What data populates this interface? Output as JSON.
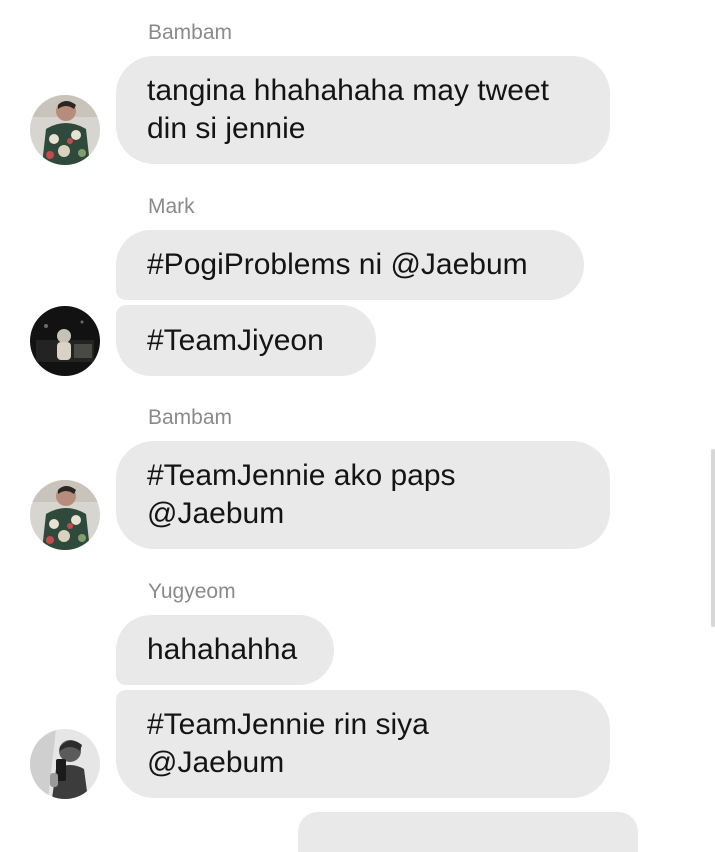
{
  "messages": [
    {
      "sender": "Bambam",
      "avatar_icon": "avatar-floral-shirt",
      "bubbles": [
        "tangina hhahahaha may tweet\ndin si jennie"
      ]
    },
    {
      "sender": "Mark",
      "avatar_icon": "avatar-dark-night-scene",
      "bubbles": [
        "#PogiProblems ni @Jaebum",
        "#TeamJiyeon"
      ]
    },
    {
      "sender": "Bambam",
      "avatar_icon": "avatar-floral-shirt",
      "bubbles": [
        "#TeamJennie ako paps\n@Jaebum"
      ]
    },
    {
      "sender": "Yugyeom",
      "avatar_icon": "avatar-grayscale-mirror-selfie",
      "bubbles": [
        "hahahahha",
        "#TeamJennie rin siya\n@Jaebum"
      ]
    }
  ],
  "colors": {
    "bubble_bg": "#e9e9ea",
    "sender_name": "#8a8a8a",
    "message_text": "#141414"
  }
}
